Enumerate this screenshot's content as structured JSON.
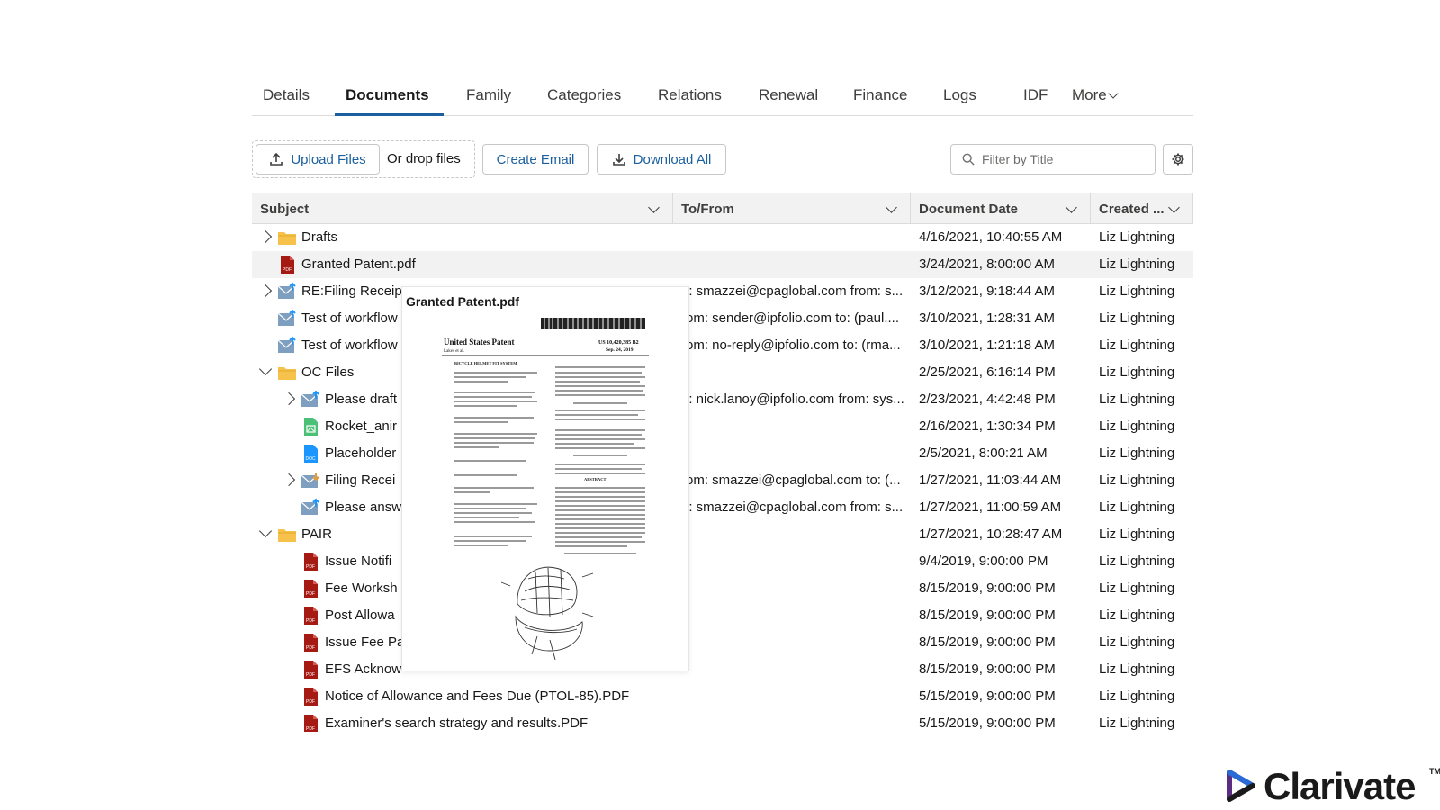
{
  "tabs": [
    {
      "label": "Details"
    },
    {
      "label": "Documents"
    },
    {
      "label": "Family"
    },
    {
      "label": "Categories"
    },
    {
      "label": "Relations"
    },
    {
      "label": "Renewal"
    },
    {
      "label": "Finance"
    },
    {
      "label": "Logs"
    },
    {
      "label": "IDF"
    },
    {
      "label": "More"
    }
  ],
  "toolbar": {
    "upload_label": "Upload Files",
    "drop_label": "Or drop files",
    "create_email_label": "Create Email",
    "download_all_label": "Download All",
    "filter_placeholder": "Filter by Title"
  },
  "columns": {
    "subject": "Subject",
    "to_from": "To/From",
    "document_date": "Document Date",
    "created": "Created ..."
  },
  "rows": [
    {
      "subject": "Drafts",
      "to_from": "",
      "date": "4/16/2021, 10:40:55 AM",
      "created": "Liz Lightning",
      "icon": "folder-icon"
    },
    {
      "subject": "Granted Patent.pdf",
      "to_from": "",
      "date": "3/24/2021, 8:00:00 AM",
      "created": "Liz Lightning",
      "icon": "pdf-icon"
    },
    {
      "subject": "RE:Filing Receip",
      "to_from": "o: smazzei@cpaglobal.com from: s...",
      "date": "3/12/2021, 9:18:44 AM",
      "created": "Liz Lightning",
      "icon": "email-icon"
    },
    {
      "subject": "Test of workflow",
      "to_from": "rom: sender@ipfolio.com to: (paul....",
      "date": "3/10/2021, 1:28:31 AM",
      "created": "Liz Lightning",
      "icon": "email-icon"
    },
    {
      "subject": "Test of workflow",
      "to_from": "rom: no-reply@ipfolio.com to: (rma...",
      "date": "3/10/2021, 1:21:18 AM",
      "created": "Liz Lightning",
      "icon": "email-icon"
    },
    {
      "subject": "OC Files",
      "to_from": "",
      "date": "2/25/2021, 6:16:14 PM",
      "created": "Liz Lightning",
      "icon": "folder-icon"
    },
    {
      "subject": "Please draft",
      "to_from": "o: nick.lanoy@ipfolio.com from: sys...",
      "date": "2/23/2021, 4:42:48 PM",
      "created": "Liz Lightning",
      "icon": "email-icon"
    },
    {
      "subject": "Rocket_anir",
      "to_from": "",
      "date": "2/16/2021, 1:30:34 PM",
      "created": "Liz Lightning",
      "icon": "image-file-icon"
    },
    {
      "subject": "Placeholder",
      "to_from": "",
      "date": "2/5/2021, 8:00:21 AM",
      "created": "Liz Lightning",
      "icon": "doc-icon"
    },
    {
      "subject": "Filing Recei",
      "to_from": "rom: smazzei@cpaglobal.com to: (...",
      "date": "1/27/2021, 11:03:44 AM",
      "created": "Liz Lightning",
      "icon": "email-in-icon"
    },
    {
      "subject": "Please answ",
      "to_from": "o: smazzei@cpaglobal.com from: s...",
      "date": "1/27/2021, 11:00:59 AM",
      "created": "Liz Lightning",
      "icon": "email-icon"
    },
    {
      "subject": "PAIR",
      "to_from": "",
      "date": "1/27/2021, 10:28:47 AM",
      "created": "Liz Lightning",
      "icon": "folder-icon"
    },
    {
      "subject": "Issue Notifi",
      "to_from": "",
      "date": "9/4/2019, 9:00:00 PM",
      "created": "Liz Lightning",
      "icon": "pdf-icon"
    },
    {
      "subject": "Fee Worksh",
      "to_from": "",
      "date": "8/15/2019, 9:00:00 PM",
      "created": "Liz Lightning",
      "icon": "pdf-icon"
    },
    {
      "subject": "Post Allowa",
      "to_from": "",
      "date": "8/15/2019, 9:00:00 PM",
      "created": "Liz Lightning",
      "icon": "pdf-icon"
    },
    {
      "subject": "Issue Fee Pa",
      "to_from": "",
      "date": "8/15/2019, 9:00:00 PM",
      "created": "Liz Lightning",
      "icon": "pdf-icon"
    },
    {
      "subject": "EFS Acknow",
      "to_from": "",
      "date": "8/15/2019, 9:00:00 PM",
      "created": "Liz Lightning",
      "icon": "pdf-icon"
    },
    {
      "subject": "Notice of Allowance and Fees Due (PTOL-85).PDF",
      "to_from": "",
      "date": "5/15/2019, 9:00:00 PM",
      "created": "Liz Lightning",
      "icon": "pdf-icon"
    },
    {
      "subject": "Examiner's search strategy and results.PDF",
      "to_from": "",
      "date": "5/15/2019, 9:00:00 PM",
      "created": "Liz Lightning",
      "icon": "pdf-icon"
    }
  ],
  "preview": {
    "title": "Granted Patent.pdf",
    "doc_heading": "United States Patent",
    "doc_patent_no": "US 10,420,385 B2",
    "doc_date": "Sep. 24, 2019",
    "doc_applicant": "Lakes et al.",
    "doc_subject": "BICYCLE HELMET FIT SYSTEM",
    "doc_abstract": "ABSTRACT"
  },
  "brand": {
    "name": "Clarivate",
    "tm": "TM"
  },
  "colors": {
    "accent": "#1b5f9e",
    "folder": "#f6c24b",
    "pdf": "#a61a14",
    "email": "#7f9fc0",
    "email_in": "#e59b3c",
    "image_file": "#4bc076",
    "doc_file": "#1b96ff"
  }
}
